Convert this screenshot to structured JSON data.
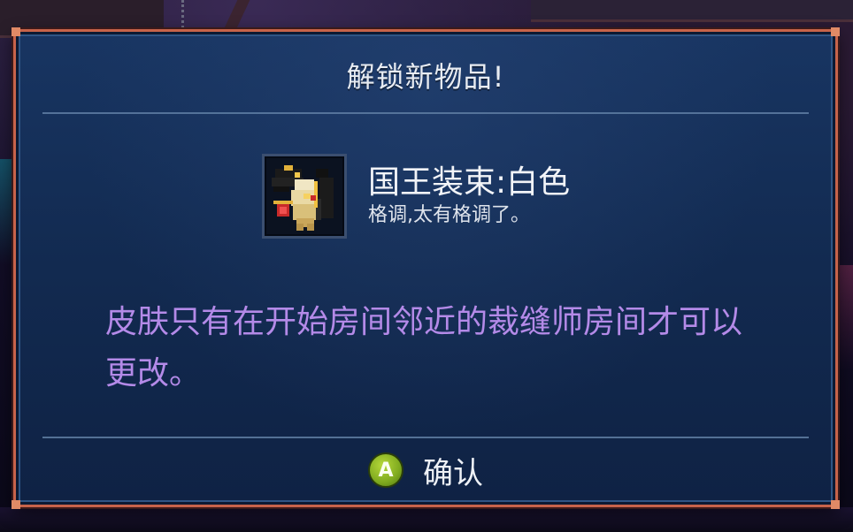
{
  "dialog": {
    "title": "解锁新物品!",
    "item": {
      "icon": "king-outfit-white-icon",
      "name": "国王装束:白色",
      "description": "格调,太有格调了。"
    },
    "message": "皮肤只有在开始房间邻近的裁缝师房间才可以更改。",
    "confirm": {
      "button_glyph": "A",
      "label": "确认"
    }
  },
  "colors": {
    "frame_border": "#c7634a",
    "panel_top": "#183562",
    "panel_bottom": "#0f2244",
    "message_text": "#b48ae8",
    "a_button": "#8bb825"
  }
}
